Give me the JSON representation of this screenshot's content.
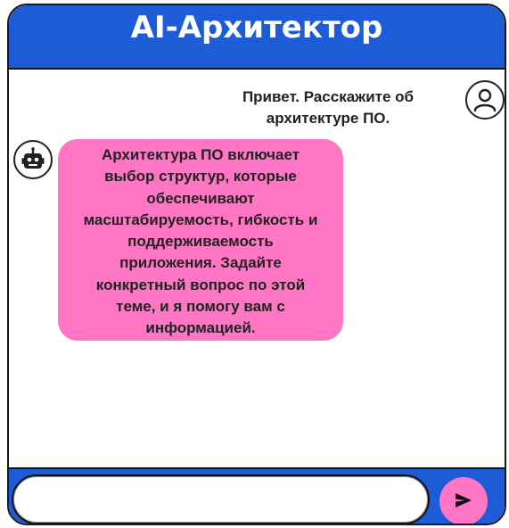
{
  "header": {
    "title": "AI-Архитектор"
  },
  "messages": [
    {
      "role": "user",
      "avatar_icon": "user-icon",
      "text": "Привет. Расскажите об архитектуре ПО."
    },
    {
      "role": "bot",
      "avatar_icon": "robot-icon",
      "text": "Архитектура ПО включает выбор структур, которые обеспечивают масштабируемость, гибкость и поддерживаемость приложения. Задайте конкретный вопрос по этой теме, и я помогу вам с информацией."
    }
  ],
  "input": {
    "value": "",
    "placeholder": ""
  },
  "send_button": {
    "icon": "send-icon"
  },
  "colors": {
    "header_bg": "#1e5bd6",
    "bot_bubble_bg": "#ff77c4",
    "send_button_bg": "#ff77c4",
    "text": "#222222"
  }
}
